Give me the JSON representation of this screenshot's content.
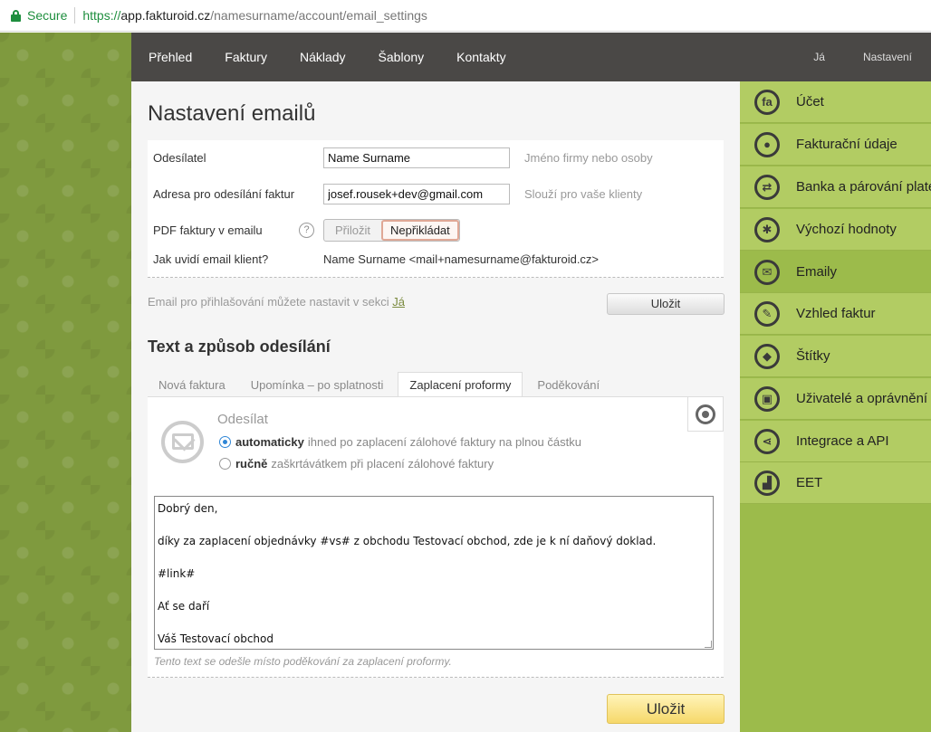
{
  "browser": {
    "secure_label": "Secure",
    "url_proto": "https://",
    "url_host": "app.fakturoid.cz",
    "url_path": "/namesurname/account/email_settings"
  },
  "topnav": {
    "items": [
      "Přehled",
      "Faktury",
      "Náklady",
      "Šablony",
      "Kontakty"
    ],
    "right": [
      "Já",
      "Nastavení"
    ]
  },
  "page": {
    "title": "Nastavení emailů"
  },
  "sender_form": {
    "sender_label": "Odesílatel",
    "sender_value": "Name Surname",
    "sender_hint": "Jméno firmy nebo osoby",
    "address_label": "Adresa pro odesílání faktur",
    "address_value": "josef.rousek+dev@gmail.com",
    "address_hint": "Slouží pro vaše klienty",
    "pdf_label": "PDF faktury v emailu",
    "pdf_options": [
      "Přiložit",
      "Nepřikládat"
    ],
    "pdf_selected": "Nepřikládat",
    "client_label": "Jak uvidí email klient?",
    "client_preview": "Name Surname <mail+namesurname@fakturoid.cz>"
  },
  "login_note": {
    "text": "Email pro přihlašování můžete nastavit v sekci ",
    "link": "Já"
  },
  "buttons": {
    "save_small": "Uložit",
    "save_big": "Uložit"
  },
  "texts_section": {
    "title": "Text a způsob odesílání",
    "tabs": [
      "Nová faktura",
      "Upomínka – po splatnosti",
      "Zaplacení proformy",
      "Poděkování"
    ],
    "active_tab": "Zaplacení proformy",
    "send_title": "Odesílat",
    "radio_auto_bold": "automaticky",
    "radio_auto_text": "ihned po zaplacení zálohové faktury na plnou částku",
    "radio_manual_bold": "ručně",
    "radio_manual_text": "zaškrtávátkem při placení zálohové faktury",
    "selected_mode": "automaticky",
    "email_lines": [
      "Dobrý den,",
      "díky za zaplacení objednávky #vs# z obchodu Testovací obchod, zde je k ní daňový doklad.",
      "#link#",
      "Ať se daří",
      "Váš Testovací obchod"
    ],
    "note": "Tento text se odešle místo poděkování za zaplacení proformy."
  },
  "sidebar": {
    "items": [
      {
        "label": "Účet",
        "icon": "fa-logo-icon",
        "glyph": "fa"
      },
      {
        "label": "Fakturační údaje",
        "icon": "user-icon",
        "glyph": "●"
      },
      {
        "label": "Banka a párování plateb",
        "icon": "sync-arrows-icon",
        "glyph": "⇄"
      },
      {
        "label": "Výchozí hodnoty",
        "icon": "gear-icon",
        "glyph": "✱"
      },
      {
        "label": "Emaily",
        "icon": "envelope-icon",
        "glyph": "✉"
      },
      {
        "label": "Vzhled faktur",
        "icon": "brush-icon",
        "glyph": "✎"
      },
      {
        "label": "Štítky",
        "icon": "tag-icon",
        "glyph": "◆"
      },
      {
        "label": "Uživatelé a oprávnění",
        "icon": "lock-icon",
        "glyph": "▣"
      },
      {
        "label": "Integrace a API",
        "icon": "share-icon",
        "glyph": "⋖"
      },
      {
        "label": "EET",
        "icon": "eet-chart-icon",
        "glyph": "▟"
      }
    ],
    "active": "Emaily"
  }
}
